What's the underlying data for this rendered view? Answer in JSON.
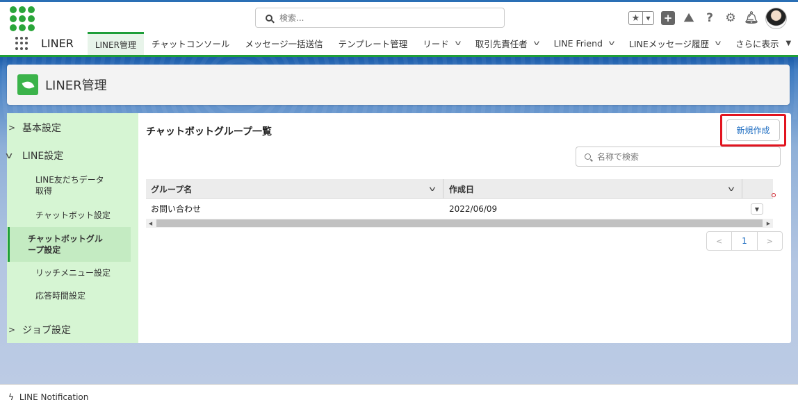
{
  "header": {
    "search_placeholder": "検索..."
  },
  "nav": {
    "app_name": "LINER",
    "tabs": [
      {
        "label": "LINER管理",
        "active": true,
        "dropdown": false
      },
      {
        "label": "チャットコンソール",
        "active": false,
        "dropdown": false
      },
      {
        "label": "メッセージ一括送信",
        "active": false,
        "dropdown": false
      },
      {
        "label": "テンプレート管理",
        "active": false,
        "dropdown": false
      },
      {
        "label": "リード",
        "active": false,
        "dropdown": true
      },
      {
        "label": "取引先責任者",
        "active": false,
        "dropdown": true
      },
      {
        "label": "LINE Friend",
        "active": false,
        "dropdown": true
      },
      {
        "label": "LINEメッセージ履歴",
        "active": false,
        "dropdown": true
      }
    ],
    "more_label": "さらに表示"
  },
  "page": {
    "title": "LINER管理"
  },
  "sidebar": {
    "sections": [
      {
        "label": "基本設定",
        "expanded": false
      },
      {
        "label": "LINE設定",
        "expanded": true
      },
      {
        "label": "ジョブ設定",
        "expanded": false
      }
    ],
    "items": [
      {
        "label": "LINE友だちデータ取得",
        "active": false
      },
      {
        "label": "チャットボット設定",
        "active": false
      },
      {
        "label": "チャットボットグループ設定",
        "active": true
      },
      {
        "label": "リッチメニュー設定",
        "active": false
      },
      {
        "label": "応答時間設定",
        "active": false
      }
    ]
  },
  "content": {
    "title": "チャットボットグループ一覧",
    "new_button": "新規作成",
    "search_placeholder": "名称で検索",
    "columns": [
      "グループ名",
      "作成日"
    ],
    "rows": [
      {
        "name": "お問い合わせ",
        "created": "2022/06/09"
      }
    ],
    "pager": {
      "prev": "<",
      "page": "1",
      "next": ">"
    }
  },
  "footer": {
    "label": "LINE Notification"
  },
  "colors": {
    "accent_green": "#1e9e39",
    "link_blue": "#1a6bc1",
    "highlight_red": "#e2141f"
  }
}
